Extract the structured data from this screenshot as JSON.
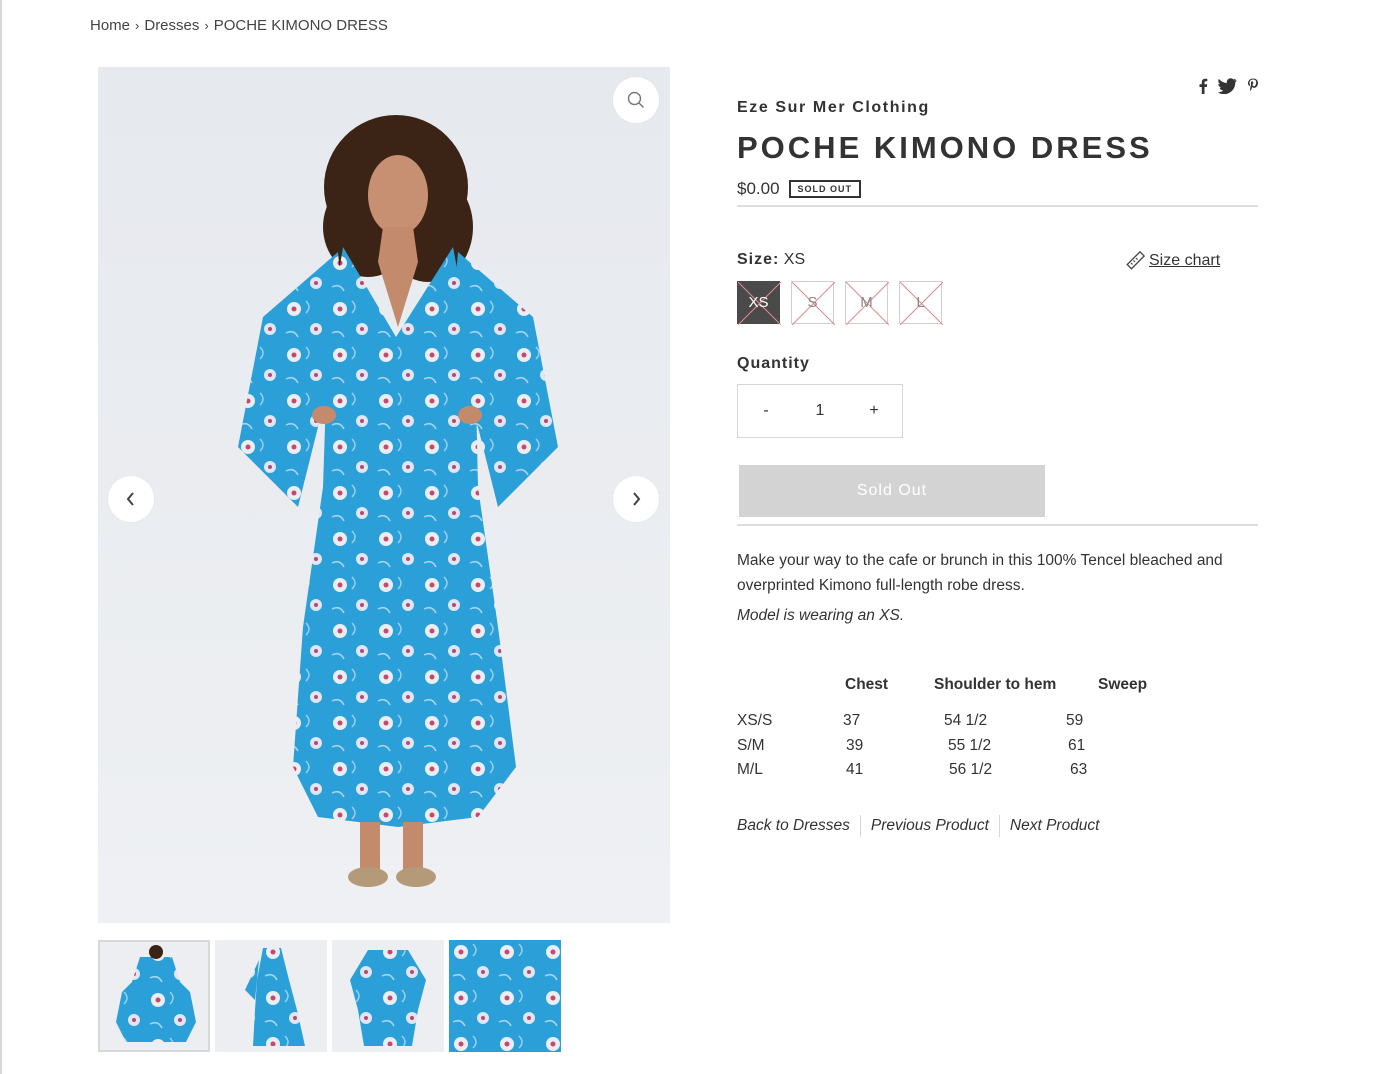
{
  "breadcrumb": {
    "home": "Home",
    "category": "Dresses",
    "current": "POCHE KIMONO DRESS",
    "separator": "›"
  },
  "gallery": {
    "zoom_icon": "search-icon",
    "prev_icon": "chevron-left-icon",
    "next_icon": "chevron-right-icon",
    "dress_color": "#2a9fd6",
    "thumb_count": 4,
    "active_thumb": 1
  },
  "product": {
    "vendor": "Eze Sur Mer Clothing",
    "title": "POCHE KIMONO DRESS",
    "price": "$0.00",
    "badge": "SOLD OUT",
    "share_icons": [
      "facebook-icon",
      "twitter-icon",
      "pinterest-icon"
    ]
  },
  "size": {
    "label": "Size:",
    "selected": "XS",
    "chart_link": "Size chart",
    "options": [
      "XS",
      "S",
      "M",
      "L"
    ]
  },
  "quantity": {
    "label": "Quantity",
    "minus": "-",
    "value": "1",
    "plus": "+"
  },
  "add_button": {
    "label": "Sold Out"
  },
  "description": {
    "text": "Make your way to the cafe or brunch in this 100% Tencel bleached and overprinted Kimono full-length robe dress.",
    "model_note": "Model is wearing an XS."
  },
  "size_table": {
    "headers": [
      "Chest",
      "Shoulder to hem",
      "Sweep"
    ],
    "rows": [
      {
        "size": "XS/S",
        "chest": "37",
        "shoulder": "54 1/2",
        "sweep": "59"
      },
      {
        "size": "S/M",
        "chest": "39",
        "shoulder": "55 1/2",
        "sweep": "61"
      },
      {
        "size": "M/L",
        "chest": "41",
        "shoulder": "56 1/2",
        "sweep": "63"
      }
    ]
  },
  "product_nav": {
    "back": "Back to Dresses",
    "previous": "Previous Product",
    "next": "Next Product"
  }
}
